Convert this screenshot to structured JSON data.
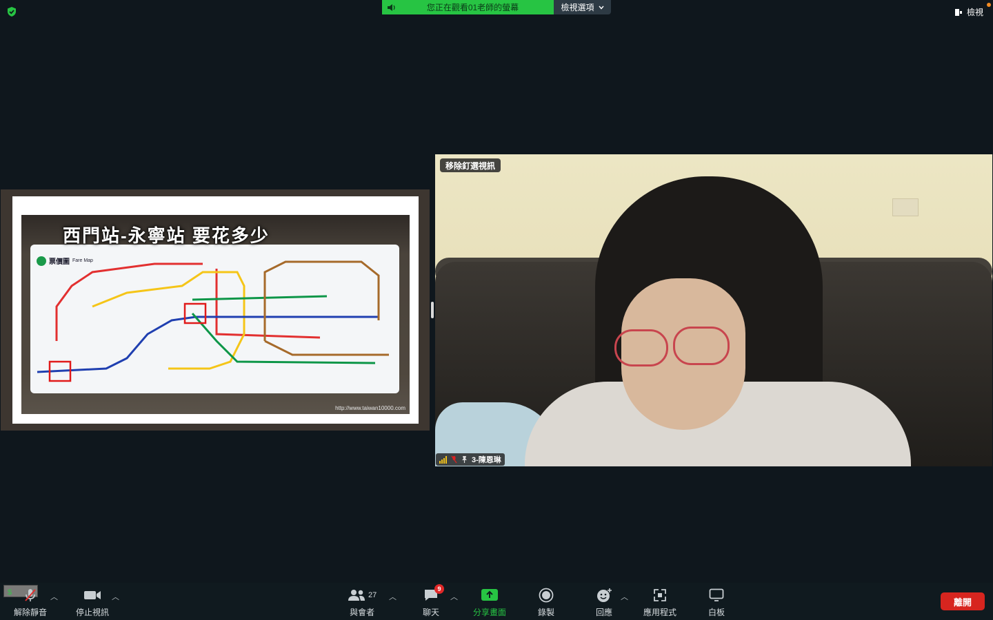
{
  "top": {
    "share_banner": "您正在觀看01老師的螢幕",
    "view_options": "檢視選項",
    "view_button": "檢視"
  },
  "share": {
    "slide_title": "西門站-永寧站 要花多少",
    "faremap_label": "票價圖",
    "faremap_sub": "Fare Map",
    "watermark": "http://www.taiwan10000.com"
  },
  "video": {
    "unpin_label": "移除釘選視訊",
    "participant_name": "3-陳恩琳"
  },
  "toolbar": {
    "mute_label": "解除靜音",
    "video_label": "停止視訊",
    "participants_label": "與會者",
    "participants_count": "27",
    "chat_label": "聊天",
    "chat_badge": "9",
    "share_label": "分享畫面",
    "record_label": "錄製",
    "reactions_label": "回應",
    "apps_label": "應用程式",
    "whiteboard_label": "白板",
    "leave_label": "離開"
  },
  "colors": {
    "share_green": "#27c443",
    "leave_red": "#d7251f",
    "background": "#0f171d"
  }
}
